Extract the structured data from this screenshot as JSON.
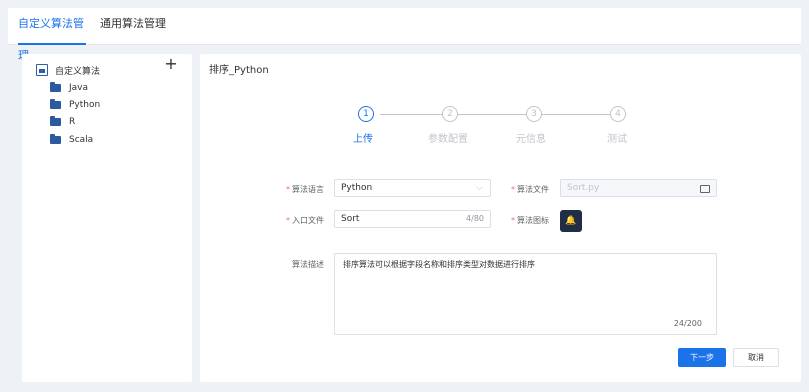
{
  "tabs": [
    {
      "label": "自定义算法管理",
      "active": true
    },
    {
      "label": "通用算法管理",
      "active": false
    }
  ],
  "tree": {
    "root_label": "自定义算法",
    "add_symbol": "+",
    "items": [
      "Java",
      "Python",
      "R",
      "Scala"
    ]
  },
  "panel": {
    "title": "排序_Python"
  },
  "steps": [
    {
      "number": "1",
      "label": "上传",
      "active": true
    },
    {
      "number": "2",
      "label": "参数配置",
      "active": false
    },
    {
      "number": "3",
      "label": "元信息",
      "active": false
    },
    {
      "number": "4",
      "label": "测试",
      "active": false
    }
  ],
  "form": {
    "language": {
      "label": "算法语言",
      "value": "Python",
      "arrow": "⌵"
    },
    "file": {
      "label": "算法文件",
      "value": "Sort.py",
      "icon": "folder-icon"
    },
    "entry": {
      "label": "入口文件",
      "value": "Sort",
      "counter": "4/80"
    },
    "icon": {
      "label": "算法图标",
      "icon": "bell-icon",
      "glyph": "🔔"
    },
    "description": {
      "label": "算法描述",
      "value": "排序算法可以根据字段名称和排序类型对数据进行排序",
      "counter": "24/200"
    }
  },
  "buttons": {
    "next": "下一步",
    "cancel": "取消"
  },
  "colors": {
    "accent": "#1a73e8",
    "background": "#eef1f6",
    "required": "#f56c6c",
    "icon_chip": "#1f2d45"
  }
}
